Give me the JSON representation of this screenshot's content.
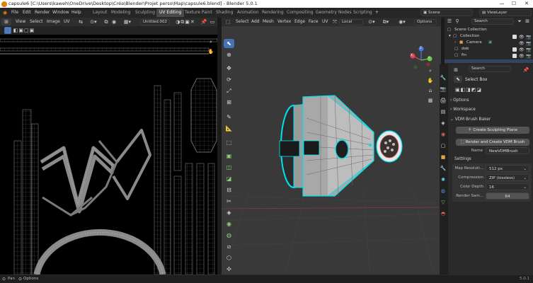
{
  "window": {
    "title": "capsule6 [C:\\Users\\kaweh\\OneDrive\\Desktop\\Créa\\Blender\\Projet perso\\Map\\capsule6.blend] - Blender 5.0.1",
    "minimize": "—",
    "maximize": "☐",
    "close": "✕"
  },
  "menubar": {
    "items": [
      "File",
      "Edit",
      "Render",
      "Window",
      "Help"
    ],
    "workspaces": [
      "Layout",
      "Modeling",
      "Sculpting",
      "UV Editing",
      "Texture Paint",
      "Shading",
      "Animation",
      "Rendering",
      "Compositing",
      "Geometry Nodes",
      "Scripting"
    ],
    "active_workspace": "UV Editing",
    "add_tab": "+",
    "scene_label": "Scene",
    "view_layer_label": "ViewLayer"
  },
  "uv_editor": {
    "menu": [
      "View",
      "Select",
      "Image",
      "UV"
    ],
    "image_name": "Untitled.002"
  },
  "viewport": {
    "menu": [
      "Select",
      "Add",
      "Mesh",
      "Vertex",
      "Edge",
      "Face",
      "UV"
    ],
    "transform_orientation": "Local",
    "options_label": "Options",
    "gizmo_axes": [
      "X",
      "Y",
      "Z"
    ]
  },
  "outliner": {
    "search_placeholder": "Search",
    "items": [
      {
        "label": "Scene Collection",
        "indent": 0
      },
      {
        "label": "Collection",
        "indent": 1
      },
      {
        "label": "Camera",
        "indent": 2
      },
      {
        "label": "deb",
        "indent": 2
      },
      {
        "label": "fin",
        "indent": 2
      }
    ]
  },
  "properties": {
    "search_placeholder": "Search",
    "active_tool": "Select Box",
    "panels": {
      "options": "Options",
      "workspace": "Workspace",
      "vdm": "VDM Brush Baker"
    },
    "create_plane_button": "Create Sculpting Plane",
    "render_button": "Render and Create VDM Brush",
    "name_label": "Name",
    "name_value": "NewVDMBrush",
    "settings_label": "Settings",
    "fields": [
      {
        "label": "Map Resoluti...",
        "value": "512 px"
      },
      {
        "label": "Compression",
        "value": "ZIP (lossless)"
      },
      {
        "label": "Color Depth",
        "value": "16"
      }
    ],
    "render_samples_label": "Render Sam...",
    "render_samples_value": "64"
  },
  "status_bar": {
    "pan": "Pan",
    "options": "Options",
    "version": "5.0.1"
  },
  "colors": {
    "accent": "#4772b3",
    "active_tab": "#4a4a4a",
    "mesh_highlight": "#00e1f0",
    "blender_orange": "#e87d0d"
  }
}
